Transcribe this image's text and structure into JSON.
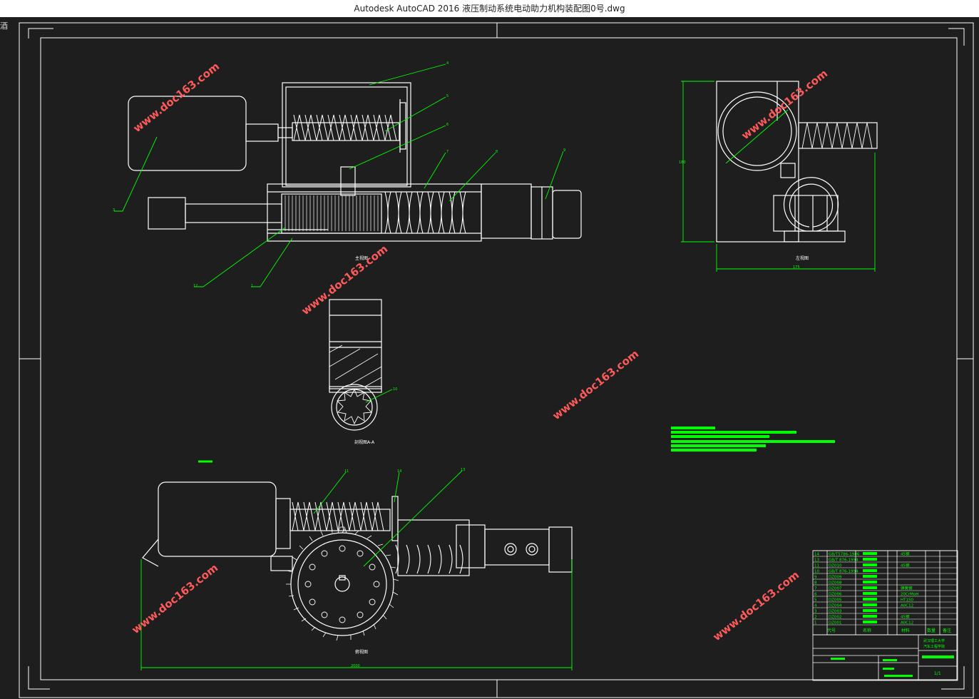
{
  "window": {
    "title": "Autodesk AutoCAD 2016     液压制动系统电动助力机构装配图0号.dwg",
    "stray_char": "酒"
  },
  "watermark": "www.doc163.com",
  "views": {
    "front_label": "主视图",
    "side_label": "左视图",
    "section_label": "剖视图A-A",
    "top_label": "俯视图"
  },
  "balloons": [
    "4",
    "5",
    "6",
    "7",
    "8",
    "9",
    "3",
    "12",
    "1",
    "10",
    "11",
    "14",
    "13"
  ],
  "dims": {
    "top_width": "2000",
    "right_width": "175",
    "right_height": "180"
  },
  "bom": {
    "rows": [
      {
        "no": "14",
        "code": "GB/T5786-1986",
        "mat": "45钢"
      },
      {
        "no": "13",
        "code": "GB/T 876-1994",
        "mat": ""
      },
      {
        "no": "11",
        "code": "DZ010",
        "mat": "45钢"
      },
      {
        "no": "10",
        "code": "GB/T 876-1994",
        "mat": ""
      },
      {
        "no": "9",
        "code": "DZ009",
        "mat": ""
      },
      {
        "no": "8",
        "code": "DZ008",
        "mat": ""
      },
      {
        "no": "7",
        "code": "DZ007",
        "mat": "弹簧钢"
      },
      {
        "no": "6",
        "code": "DZ006",
        "mat": "20CrMoH"
      },
      {
        "no": "5",
        "code": "DZ005",
        "mat": "HT150"
      },
      {
        "no": "4",
        "code": "DZ004",
        "mat": "A0C12"
      },
      {
        "no": "3",
        "code": "DZ003",
        "mat": ""
      },
      {
        "no": "2",
        "code": "DZ002",
        "mat": "45钢"
      },
      {
        "no": "1",
        "code": "DZ001",
        "mat": "A0C12"
      }
    ],
    "header": {
      "code": "代号",
      "name": "名称",
      "mat": "材料",
      "qty": "数量",
      "note": "备注"
    },
    "school1": "武汉理工大学",
    "school2": "汽车工程学院",
    "sheet": "1/1"
  },
  "colors": {
    "line": "#ffffff",
    "leader": "#00ff00",
    "watermark": "#ff5a5a",
    "bg": "#1e1e1e"
  }
}
